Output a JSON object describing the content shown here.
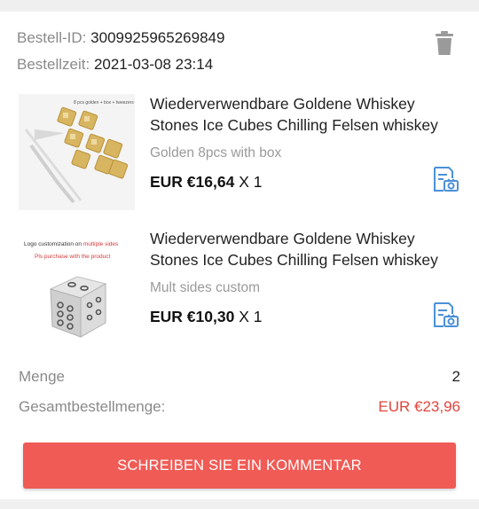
{
  "order": {
    "id_label": "Bestell-ID:",
    "id_value": "3009925965269849",
    "time_label": "Bestellzeit:",
    "time_value": "2021-03-08 23:14"
  },
  "items": [
    {
      "title": "Wiederverwendbare Goldene Whiskey Stones Ice Cubes Chilling Felsen whiskey",
      "thumb_caption": "8 pcs golden + box + tweezers",
      "variant": "Golden 8pcs with box",
      "price": "EUR €16,64",
      "qty": "X 1"
    },
    {
      "title": "Wiederverwendbare Goldene Whiskey Stones Ice Cubes Chilling Felsen whiskey",
      "thumb_caption_1a": "Logo customization on ",
      "thumb_caption_1b": "multiple sides",
      "thumb_caption_2": "Pls purchase with the product",
      "variant": "Mult sides custom",
      "price": "EUR €10,30",
      "qty": "X 1"
    }
  ],
  "summary": {
    "qty_label": "Menge",
    "qty_value": "2",
    "total_label": "Gesamtbestellmenge:",
    "total_value": "EUR €23,96",
    "total_color": "#e0463c"
  },
  "comment_button": "SCHREIBEN SIE EIN KOMMENTAR",
  "icons": {
    "delete": "trash-icon",
    "review": "photo-review-icon"
  },
  "colors": {
    "accent_button": "#f05b55",
    "icon_blue": "#4a90d9"
  }
}
